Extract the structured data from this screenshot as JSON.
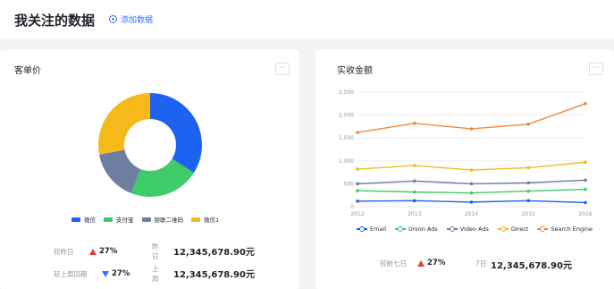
{
  "header": {
    "title": "我关注的数据",
    "add_label": "添加数据"
  },
  "cards": {
    "left": {
      "title": "客单价",
      "more": "···",
      "donut": {
        "slices": [
          {
            "label": "微信",
            "value": 34,
            "color": "#1d62f0"
          },
          {
            "label": "支付宝",
            "value": 22,
            "color": "#3ecb6a"
          },
          {
            "label": "银联二维码",
            "value": 16,
            "color": "#6e7ea0"
          },
          {
            "label": "微信1",
            "value": 28,
            "color": "#f5b91c"
          }
        ]
      },
      "stats": [
        {
          "label": "较昨日",
          "pct": "27%",
          "direction": "up",
          "sub": "昨日",
          "value": "12,345,678.90元"
        },
        {
          "label": "较上周同期",
          "pct": "27%",
          "direction": "down",
          "sub": "上周",
          "value": "12,345,678.90元"
        }
      ]
    },
    "right": {
      "title": "实收金额",
      "more": "···",
      "stat": {
        "label": "较前七日",
        "pct": "27%",
        "direction": "up",
        "sub": "7日",
        "value": "12,345,678.90元"
      }
    }
  },
  "chart_data": {
    "type": "line",
    "x": [
      "2012",
      "2013",
      "2014",
      "2015",
      "2016"
    ],
    "y_ticks": [
      "0",
      "500",
      "1,000",
      "1,500",
      "2,000",
      "2,500"
    ],
    "ylim": [
      0,
      2500
    ],
    "grid": true,
    "legend_position": "bottom",
    "series": [
      {
        "name": "Email",
        "color": "#1d62f0",
        "values": [
          120,
          130,
          100,
          130,
          90
        ]
      },
      {
        "name": "Union Ads",
        "color": "#3ecb6a",
        "values": [
          350,
          320,
          300,
          340,
          380
        ]
      },
      {
        "name": "Video Ads",
        "color": "#6e7ea0",
        "values": [
          500,
          560,
          500,
          520,
          580
        ]
      },
      {
        "name": "Direct",
        "color": "#f5b91c",
        "values": [
          820,
          900,
          800,
          850,
          970
        ]
      },
      {
        "name": "Search Engine",
        "color": "#f0883a",
        "values": [
          1620,
          1820,
          1700,
          1800,
          2250
        ]
      }
    ]
  }
}
